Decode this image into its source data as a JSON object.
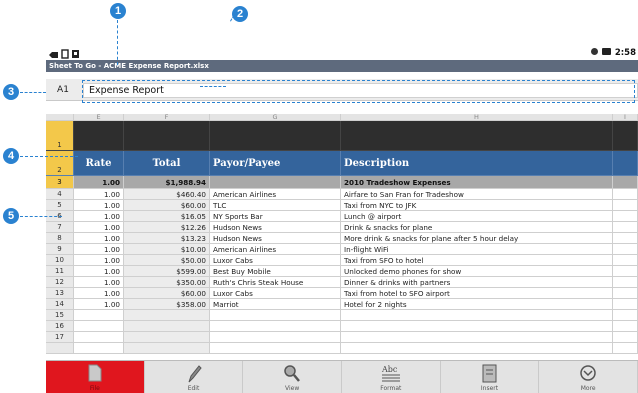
{
  "status": {
    "time": "2:58"
  },
  "title_bar": {
    "text": "Sheet To Go - ACME Expense Report.xlsx"
  },
  "formula_bar": {
    "cell_ref": "A1",
    "value": "Expense Report"
  },
  "columns": [
    "E",
    "F",
    "G",
    "H",
    "I"
  ],
  "header_row": {
    "rate": "Rate",
    "total": "Total",
    "payor": "Payor/Payee",
    "description": "Description"
  },
  "total_row": {
    "rate": "1.00",
    "total": "$1,988.94",
    "payor": "",
    "description": "2010 Tradeshow Expenses"
  },
  "rows": [
    {
      "n": "4",
      "rate": "1.00",
      "total": "$460.40",
      "payor": "American Airlines",
      "desc": "Airfare to San Fran for Tradeshow"
    },
    {
      "n": "5",
      "rate": "1.00",
      "total": "$60.00",
      "payor": "TLC",
      "desc": "Taxi from NYC to JFK"
    },
    {
      "n": "6",
      "rate": "1.00",
      "total": "$16.05",
      "payor": "NY Sports Bar",
      "desc": "Lunch @ airport"
    },
    {
      "n": "7",
      "rate": "1.00",
      "total": "$12.26",
      "payor": "Hudson News",
      "desc": "Drink & snacks for plane"
    },
    {
      "n": "8",
      "rate": "1.00",
      "total": "$13.23",
      "payor": "Hudson News",
      "desc": "More drink & snacks for plane after 5 hour delay"
    },
    {
      "n": "9",
      "rate": "1.00",
      "total": "$10.00",
      "payor": "American Airlines",
      "desc": "In-flight WiFi"
    },
    {
      "n": "10",
      "rate": "1.00",
      "total": "$50.00",
      "payor": "Luxor Cabs",
      "desc": "Taxi from SFO to hotel"
    },
    {
      "n": "11",
      "rate": "1.00",
      "total": "$599.00",
      "payor": "Best Buy Mobile",
      "desc": "Unlocked demo phones for show"
    },
    {
      "n": "12",
      "rate": "1.00",
      "total": "$350.00",
      "payor": "Ruth's Chris Steak House",
      "desc": "Dinner & drinks with partners"
    },
    {
      "n": "13",
      "rate": "1.00",
      "total": "$60.00",
      "payor": "Luxor Cabs",
      "desc": "Taxi from hotel to SFO airport"
    },
    {
      "n": "14",
      "rate": "1.00",
      "total": "$358.00",
      "payor": "Marriot",
      "desc": "Hotel for 2 nights"
    },
    {
      "n": "15",
      "rate": "",
      "total": "",
      "payor": "",
      "desc": ""
    },
    {
      "n": "16",
      "rate": "",
      "total": "",
      "payor": "",
      "desc": ""
    },
    {
      "n": "17",
      "rate": "",
      "total": "",
      "payor": "",
      "desc": ""
    }
  ],
  "toolbar": [
    {
      "label": "File",
      "icon": "file-icon"
    },
    {
      "label": "Edit",
      "icon": "pencil-icon"
    },
    {
      "label": "View",
      "icon": "magnifier-icon"
    },
    {
      "label": "Format",
      "icon": "format-icon"
    },
    {
      "label": "Insert",
      "icon": "insert-icon"
    },
    {
      "label": "More",
      "icon": "more-icon"
    }
  ],
  "callouts": [
    "1",
    "2",
    "3",
    "4",
    "5"
  ],
  "colors": {
    "header_blue": "#34649c",
    "total_gray": "#a8a8a8",
    "active_red": "#e0161e",
    "callout_blue": "#2a82d0",
    "row_header_gold": "#f3c84a"
  }
}
